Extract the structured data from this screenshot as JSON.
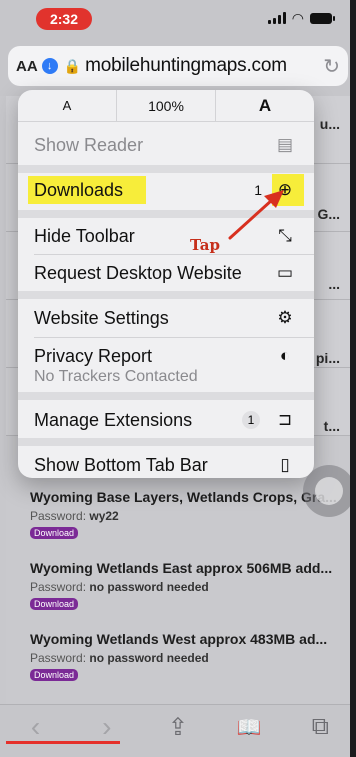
{
  "status_bar": {
    "time": "2:32"
  },
  "address_bar": {
    "text_size_label": "AA",
    "url": "mobilehuntingmaps.com",
    "icons": {
      "download": "download-progress-icon",
      "lock": "lock-icon",
      "reload": "reload-icon"
    }
  },
  "menu": {
    "zoom": {
      "decrease": "A",
      "level": "100%",
      "increase": "A"
    },
    "items": [
      {
        "label": "Show Reader",
        "icon": "reader-icon"
      },
      {
        "label": "Downloads",
        "count": "1",
        "icon": "download-circle-icon"
      },
      {
        "label": "Hide Toolbar",
        "icon": "expand-arrows-icon"
      },
      {
        "label": "Request Desktop Website",
        "icon": "desktop-icon"
      },
      {
        "label": "Website Settings",
        "icon": "settings-gear-icon"
      },
      {
        "label": "Privacy Report",
        "sublabel": "No Trackers Contacted",
        "icon": "privacy-shield-icon"
      },
      {
        "label": "Manage Extensions",
        "count": "1",
        "icon": "extensions-icon"
      },
      {
        "label": "Show Bottom Tab Bar",
        "icon": "tab-bar-icon"
      }
    ]
  },
  "annotation": {
    "tap_label": "Tap",
    "highlight_color": "#f7ed3a",
    "arrow_color": "#d8301f"
  },
  "background_peeks": [
    "u...",
    "G...",
    "...",
    "pi...",
    "t..."
  ],
  "page_list": [
    {
      "title": "Wyoming Base Layers, Wetlands Crops, Gra...",
      "password_label": "Password:",
      "password": "wy22",
      "button": "Download"
    },
    {
      "title": "Wyoming Wetlands East approx 506MB add...",
      "password_label": "Password:",
      "password": "no password needed",
      "button": "Download"
    },
    {
      "title": "Wyoming Wetlands West approx 483MB ad...",
      "password_label": "Password:",
      "password": "no password needed",
      "button": "Download"
    }
  ],
  "toolbar": {
    "back": "‹",
    "forward": "›",
    "share": "⇪",
    "bookmarks": "📖",
    "tabs": "⧉"
  },
  "colors": {
    "accent": "#2f7bf6",
    "time_pill": "#e1332d",
    "download_badge": "#7b2a96"
  }
}
